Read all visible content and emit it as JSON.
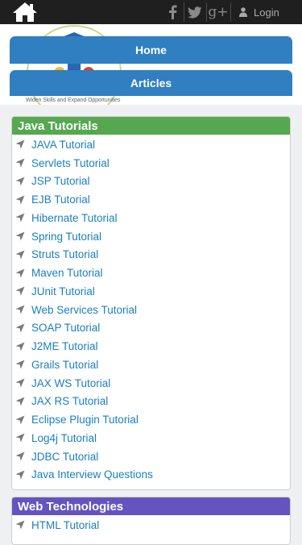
{
  "topbar": {
    "icons": [
      "home-icon",
      "facebook-icon",
      "twitter-icon",
      "google-plus-icon",
      "user-icon"
    ],
    "login_label": "Login",
    "google_plus_glyph": "g+"
  },
  "header": {
    "logo": "site-logo",
    "tagline": "Widen Skills and Expand Opportunities",
    "nav": [
      {
        "label": "Home"
      },
      {
        "label": "Articles"
      }
    ]
  },
  "java_tutorials": {
    "title": "Java Tutorials",
    "color": "#55a84f",
    "items": [
      "JAVA Tutorial",
      "Servlets Tutorial",
      "JSP Tutorial",
      "EJB Tutorial",
      "Hibernate Tutorial",
      "Spring Tutorial",
      "Struts Tutorial",
      "Maven Tutorial",
      "JUnit Tutorial",
      "Web Services Tutorial",
      "SOAP Tutorial",
      "J2ME Tutorial",
      "Grails Tutorial",
      "JAX WS Tutorial",
      "JAX RS Tutorial",
      "Eclipse Plugin Tutorial",
      "Log4j Tutorial",
      "JDBC Tutorial",
      "Java Interview Questions"
    ]
  },
  "web_technologies": {
    "title": "Web Technologies",
    "color": "#6553c0",
    "items": [
      "HTML Tutorial"
    ]
  },
  "colors": {
    "link": "#1a7fc0",
    "nav": "#2f7fc1",
    "topbar": "#1f1f1f"
  }
}
